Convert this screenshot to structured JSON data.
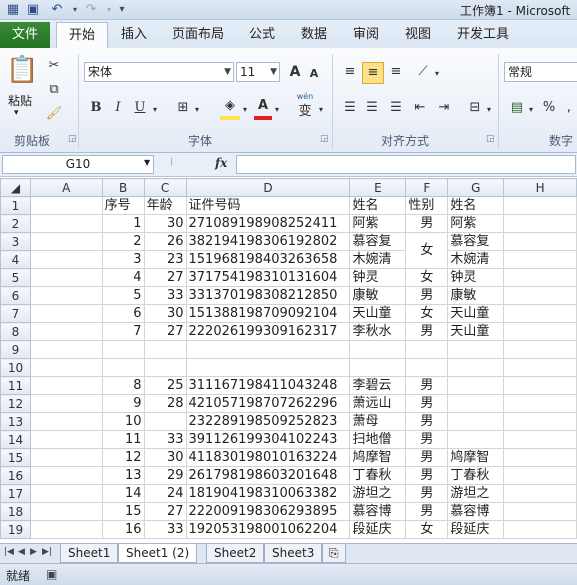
{
  "titlebar": {
    "title": "工作簿1 - Microsoft"
  },
  "quick_access": [
    "save-icon",
    "undo-icon",
    "redo-icon",
    "customize-icon"
  ],
  "tabs": [
    "文件",
    "开始",
    "插入",
    "页面布局",
    "公式",
    "数据",
    "审阅",
    "视图",
    "开发工具"
  ],
  "ribbon": {
    "clipboard": {
      "paste_label": "粘贴",
      "group_label": "剪贴板"
    },
    "font": {
      "font_name": "宋体",
      "font_size": "11",
      "group_label": "字体",
      "bold": "B",
      "italic": "I",
      "underline": "U",
      "grow": "A",
      "shrink": "A",
      "font_color": "A",
      "wen": "wén",
      "wen_char": "变"
    },
    "alignment": {
      "group_label": "对齐方式"
    },
    "number": {
      "format": "常规",
      "group_label": "数字",
      "percent": "%"
    }
  },
  "formula_bar": {
    "cell_ref": "G10",
    "fx": "fx",
    "value": ""
  },
  "grid": {
    "col_headers": [
      "A",
      "B",
      "C",
      "D",
      "E",
      "F",
      "G",
      "H"
    ],
    "rows": [
      {
        "n": "1",
        "b": "序号",
        "c": "年龄",
        "d": "证件号码",
        "e": "姓名",
        "f": "性别",
        "g": "姓名"
      },
      {
        "n": "2",
        "b": "1",
        "c": "30",
        "d": "271089198908252411",
        "e": "阿紫",
        "f": "男",
        "g": "阿紫"
      },
      {
        "n": "3",
        "b": "2",
        "c": "26",
        "d": "382194198306192802",
        "e": "慕容复",
        "f": "女",
        "g": "慕容复"
      },
      {
        "n": "4",
        "b": "3",
        "c": "23",
        "d": "151968198403263658",
        "e": "木婉清",
        "f": "",
        "g": "木婉清"
      },
      {
        "n": "5",
        "b": "4",
        "c": "27",
        "d": "371754198310131604",
        "e": "钟灵",
        "f": "女",
        "g": "钟灵"
      },
      {
        "n": "6",
        "b": "5",
        "c": "33",
        "d": "331370198308212850",
        "e": "康敏",
        "f": "男",
        "g": "康敏"
      },
      {
        "n": "7",
        "b": "6",
        "c": "30",
        "d": "151388198709092104",
        "e": "天山童",
        "f": "女",
        "g": "天山童"
      },
      {
        "n": "8",
        "b": "7",
        "c": "27",
        "d": "222026199309162317",
        "e": "李秋水",
        "f": "男",
        "g": "天山童"
      },
      {
        "n": "9",
        "b": "",
        "c": "",
        "d": "",
        "e": "",
        "f": "",
        "g": ""
      },
      {
        "n": "10",
        "b": "",
        "c": "",
        "d": "",
        "e": "",
        "f": "",
        "g": ""
      },
      {
        "n": "11",
        "b": "8",
        "c": "25",
        "d": "311167198411043248",
        "e": "李碧云",
        "f": "男",
        "g": ""
      },
      {
        "n": "12",
        "b": "9",
        "c": "28",
        "d": "421057198707262296",
        "e": "萧远山",
        "f": "男",
        "g": ""
      },
      {
        "n": "13",
        "b": "10",
        "c": "",
        "d": "232289198509252823",
        "e": "萧母",
        "f": "男",
        "g": ""
      },
      {
        "n": "14",
        "b": "11",
        "c": "33",
        "d": "391126199304102243",
        "e": "扫地僧",
        "f": "男",
        "g": ""
      },
      {
        "n": "15",
        "b": "12",
        "c": "30",
        "d": "411830198010163224",
        "e": "鸠摩智",
        "f": "男",
        "g": "鸠摩智"
      },
      {
        "n": "16",
        "b": "13",
        "c": "29",
        "d": "261798198603201648",
        "e": "丁春秋",
        "f": "男",
        "g": "丁春秋"
      },
      {
        "n": "17",
        "b": "14",
        "c": "24",
        "d": "181904198310063382",
        "e": "游坦之",
        "f": "男",
        "g": "游坦之"
      },
      {
        "n": "18",
        "b": "15",
        "c": "27",
        "d": "222009198306293895",
        "e": "慕容博",
        "f": "男",
        "g": "慕容博"
      },
      {
        "n": "19",
        "b": "16",
        "c": "33",
        "d": "192053198001062204",
        "e": "段延庆",
        "f": "女",
        "g": "段延庆"
      }
    ]
  },
  "sheet_tabs": [
    "Sheet1",
    "Sheet1 (2)",
    "Sheet2",
    "Sheet3"
  ],
  "status": {
    "text": "就绪"
  }
}
